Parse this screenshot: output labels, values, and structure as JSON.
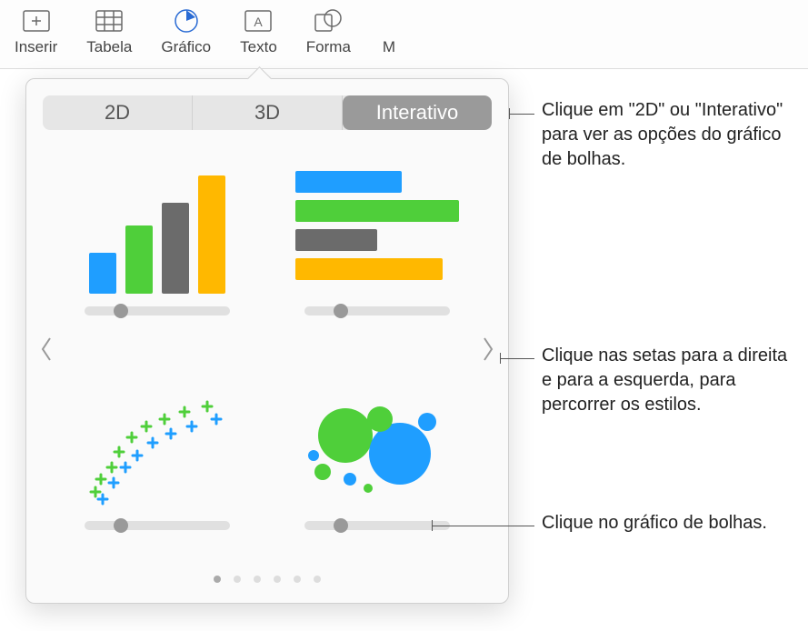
{
  "toolbar": {
    "items": [
      {
        "label": "Inserir"
      },
      {
        "label": "Tabela"
      },
      {
        "label": "Gráfico"
      },
      {
        "label": "Texto"
      },
      {
        "label": "Forma"
      },
      {
        "label": "M"
      }
    ]
  },
  "popover": {
    "tabs": [
      {
        "label": "2D"
      },
      {
        "label": "3D"
      },
      {
        "label": "Interativo"
      }
    ],
    "active_tab": "Interativo",
    "page_count": 6,
    "active_page": 0,
    "colors": {
      "blue": "#1f9eff",
      "green": "#4fcf3a",
      "gray": "#6b6b6b",
      "yellow": "#ffb800"
    }
  },
  "callouts": {
    "tabs": "Clique em \"2D\" ou \"Interativo\" para ver as opções do gráfico de bolhas.",
    "arrows": "Clique nas setas para a direita e para a esquerda, para percorrer os estilos.",
    "bubble": "Clique no gráfico de bolhas."
  }
}
